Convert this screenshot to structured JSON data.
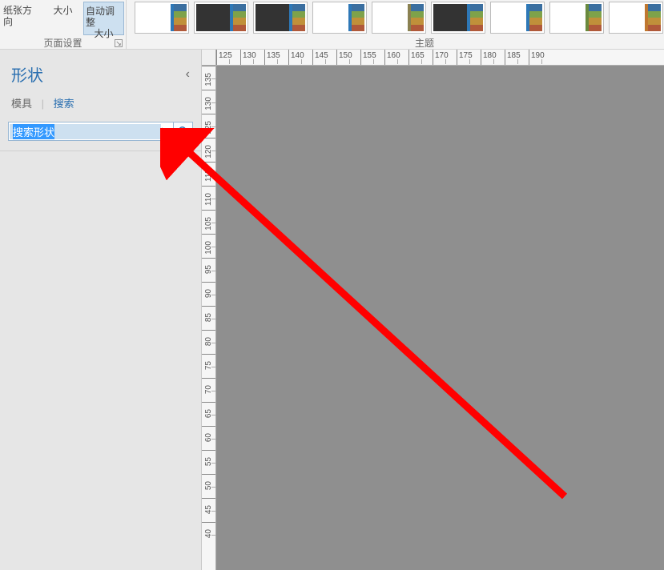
{
  "ribbon": {
    "page_setup": {
      "orientation": "纸张方向",
      "size": "大小",
      "auto_fit_line1": "自动调整",
      "auto_fit_line2": "大小",
      "group_label": "页面设置"
    },
    "themes": {
      "group_label": "主题"
    }
  },
  "shapes_panel": {
    "title": "形状",
    "tab_stencil": "模具",
    "tab_search": "搜索",
    "search_placeholder": "搜索形状",
    "search_value": "搜索形状"
  },
  "ruler_h": [
    "125",
    "130",
    "135",
    "140",
    "145",
    "150",
    "155",
    "160",
    "165",
    "170",
    "175",
    "180",
    "185",
    "190"
  ],
  "ruler_v": [
    "135",
    "130",
    "125",
    "120",
    "115",
    "110",
    "105",
    "100",
    "95",
    "90",
    "85",
    "80",
    "75",
    "70",
    "65",
    "60",
    "55",
    "50",
    "45",
    "40"
  ]
}
